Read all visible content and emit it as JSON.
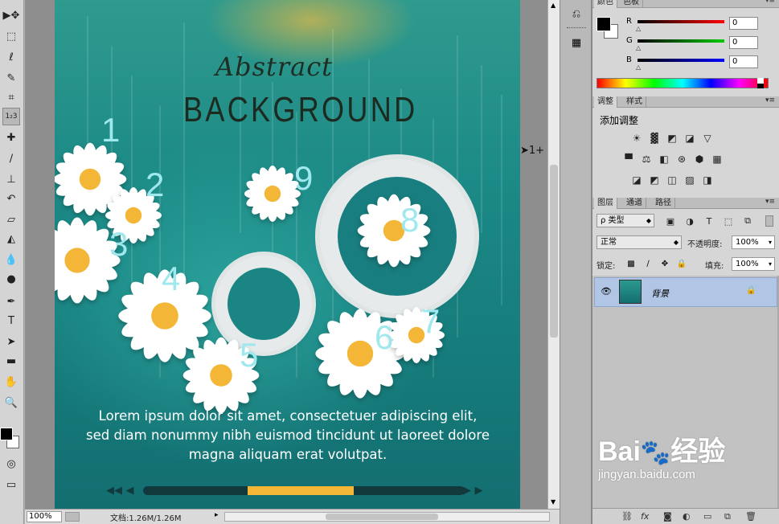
{
  "toolbar": {
    "tools": [
      {
        "name": "move-tool",
        "glyph": "▶✥"
      },
      {
        "name": "marquee-tool",
        "glyph": "⬚"
      },
      {
        "name": "lasso-tool",
        "glyph": "ℓ"
      },
      {
        "name": "quick-select-tool",
        "glyph": "✎"
      },
      {
        "name": "crop-tool",
        "glyph": "⌗"
      },
      {
        "name": "count-tool",
        "glyph": "1₂3"
      },
      {
        "name": "healing-tool",
        "glyph": "✚"
      },
      {
        "name": "brush-tool",
        "glyph": "∕"
      },
      {
        "name": "stamp-tool",
        "glyph": "⊥"
      },
      {
        "name": "history-brush-tool",
        "glyph": "↶"
      },
      {
        "name": "eraser-tool",
        "glyph": "▱"
      },
      {
        "name": "bucket-tool",
        "glyph": "◭"
      },
      {
        "name": "blur-tool",
        "glyph": "💧"
      },
      {
        "name": "dodge-tool",
        "glyph": "●"
      },
      {
        "name": "pen-tool",
        "glyph": "✒"
      },
      {
        "name": "type-tool",
        "glyph": "T"
      },
      {
        "name": "path-select-tool",
        "glyph": "➤"
      },
      {
        "name": "shape-tool",
        "glyph": "▬"
      },
      {
        "name": "hand-tool",
        "glyph": "✋"
      },
      {
        "name": "zoom-tool",
        "glyph": "🔍"
      }
    ]
  },
  "poster": {
    "title_script": "Abstract",
    "title_main": "BACKGROUND",
    "numbers": [
      "1",
      "2",
      "3",
      "4",
      "5",
      "6",
      "7",
      "8",
      "9"
    ],
    "body_lines": [
      "Lorem ipsum dolor sit amet, consectetuer adipiscing elit,",
      "sed diam nonummy nibh euismod tincidunt ut laoreet dolore",
      "magna aliquam erat volutpat."
    ],
    "progress": 0.33,
    "cursor_label": "1+"
  },
  "status": {
    "zoom": "100%",
    "doc": "文档:1.26M/1.26M"
  },
  "color_panel": {
    "tabs": [
      "颜色",
      "色板"
    ],
    "channels": [
      {
        "label": "R",
        "value": "0"
      },
      {
        "label": "G",
        "value": "0"
      },
      {
        "label": "B",
        "value": "0"
      }
    ]
  },
  "adjust_panel": {
    "tabs": [
      "调整",
      "样式"
    ],
    "heading": "添加调整"
  },
  "layers_panel": {
    "tabs": [
      "图层",
      "通道",
      "路径"
    ],
    "filter_label": "ρ 类型",
    "blend_mode": "正常",
    "opacity_label": "不透明度:",
    "opacity_value": "100%",
    "lock_label": "锁定:",
    "fill_label": "填充:",
    "fill_value": "100%",
    "layer_name": "背景"
  },
  "watermark": {
    "brand": "Bai",
    "brand2": "经验",
    "url": "jingyan.baidu.com"
  },
  "colors": {
    "accent_yellow": "#f4b636",
    "number_cyan": "#9fe8ee",
    "layer_select": "#b0c6e4"
  }
}
